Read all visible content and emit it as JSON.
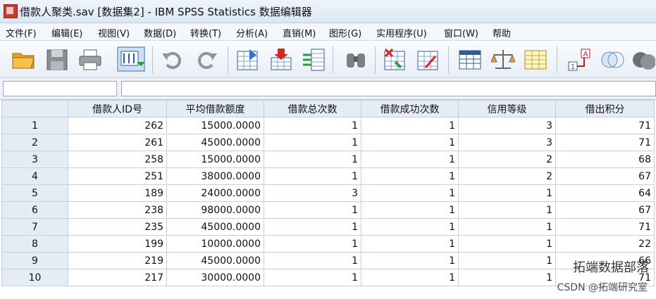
{
  "window": {
    "title": "借款人聚类.sav [数据集2] - IBM SPSS Statistics 数据编辑器"
  },
  "menu": [
    "文件(F)",
    "编辑(E)",
    "视图(V)",
    "数据(D)",
    "转换(T)",
    "分析(A)",
    "直销(M)",
    "图形(G)",
    "实用程序(U)",
    "窗口(W)",
    "帮助"
  ],
  "toolbar_icons": [
    "open-folder-icon",
    "save-icon",
    "print-icon",
    "dialog-recall-icon",
    "undo-icon",
    "redo-icon",
    "goto-case-icon",
    "goto-variable-icon",
    "variables-icon",
    "find-icon",
    "insert-cases-icon",
    "insert-variable-icon",
    "split-file-icon",
    "weight-cases-icon",
    "select-cases-icon",
    "value-labels-icon",
    "use-sets-icon",
    "show-all-variables-icon"
  ],
  "table": {
    "columns": [
      "借款人ID号",
      "平均借款额度",
      "借款总次数",
      "借款成功次数",
      "信用等级",
      "借出积分"
    ],
    "rows": [
      [
        "1",
        "262",
        "15000.0000",
        "1",
        "1",
        "3",
        "71"
      ],
      [
        "2",
        "261",
        "45000.0000",
        "1",
        "1",
        "3",
        "71"
      ],
      [
        "3",
        "258",
        "15000.0000",
        "1",
        "1",
        "2",
        "68"
      ],
      [
        "4",
        "251",
        "38000.0000",
        "1",
        "1",
        "2",
        "67"
      ],
      [
        "5",
        "189",
        "24000.0000",
        "3",
        "1",
        "1",
        "64"
      ],
      [
        "6",
        "238",
        "98000.0000",
        "1",
        "1",
        "1",
        "67"
      ],
      [
        "7",
        "235",
        "45000.0000",
        "1",
        "1",
        "1",
        "71"
      ],
      [
        "8",
        "199",
        "10000.0000",
        "1",
        "1",
        "1",
        "22"
      ],
      [
        "9",
        "219",
        "45000.0000",
        "1",
        "1",
        "1",
        "66"
      ],
      [
        "10",
        "217",
        "30000.0000",
        "1",
        "1",
        "1",
        "71"
      ]
    ]
  },
  "watermark": {
    "main": "拓端数据部落",
    "sub": "CSDN @拓端研究室"
  }
}
